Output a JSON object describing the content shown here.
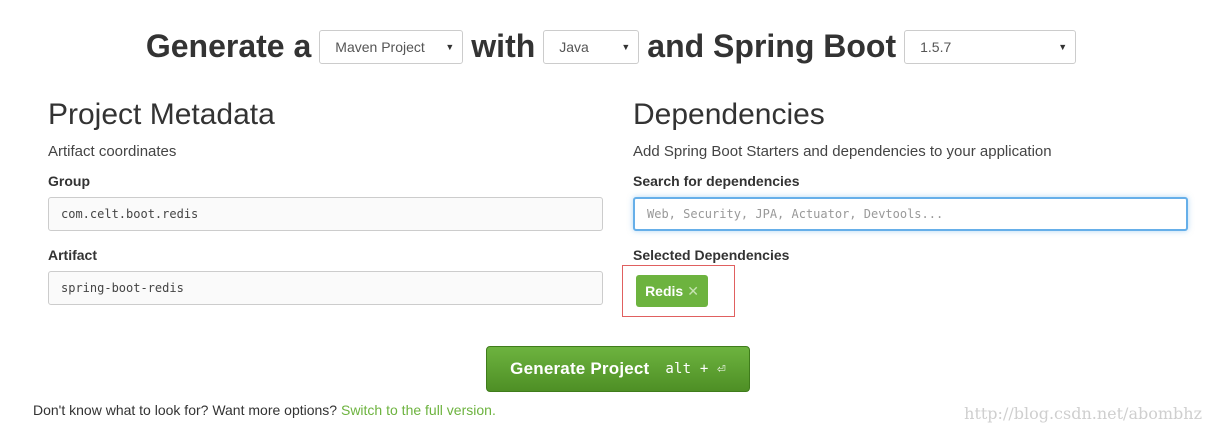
{
  "header": {
    "generate_text": "Generate a",
    "with_text": "with",
    "and_text": "and Spring Boot",
    "project_type": "Maven Project",
    "language": "Java",
    "boot_version": "1.5.7"
  },
  "metadata": {
    "title": "Project Metadata",
    "subtitle": "Artifact coordinates",
    "group_label": "Group",
    "group_value": "com.celt.boot.redis",
    "artifact_label": "Artifact",
    "artifact_value": "spring-boot-redis"
  },
  "dependencies": {
    "title": "Dependencies",
    "subtitle": "Add Spring Boot Starters and dependencies to your application",
    "search_label": "Search for dependencies",
    "search_placeholder": "Web, Security, JPA, Actuator, Devtools...",
    "selected_label": "Selected Dependencies",
    "selected": [
      "Redis"
    ],
    "remove_glyph": "✕"
  },
  "actions": {
    "generate_label": "Generate Project",
    "shortcut": "alt + ⏎"
  },
  "footer": {
    "text": "Don't know what to look for? Want more options?",
    "link": "Switch to the full version."
  },
  "watermark": "http://blog.csdn.net/abombhz",
  "colors": {
    "accent": "#6db33f",
    "focus": "#66afe9",
    "highlight_box": "#e06060"
  },
  "icons": {
    "dropdown": "caret-down-icon",
    "remove": "close-icon"
  }
}
